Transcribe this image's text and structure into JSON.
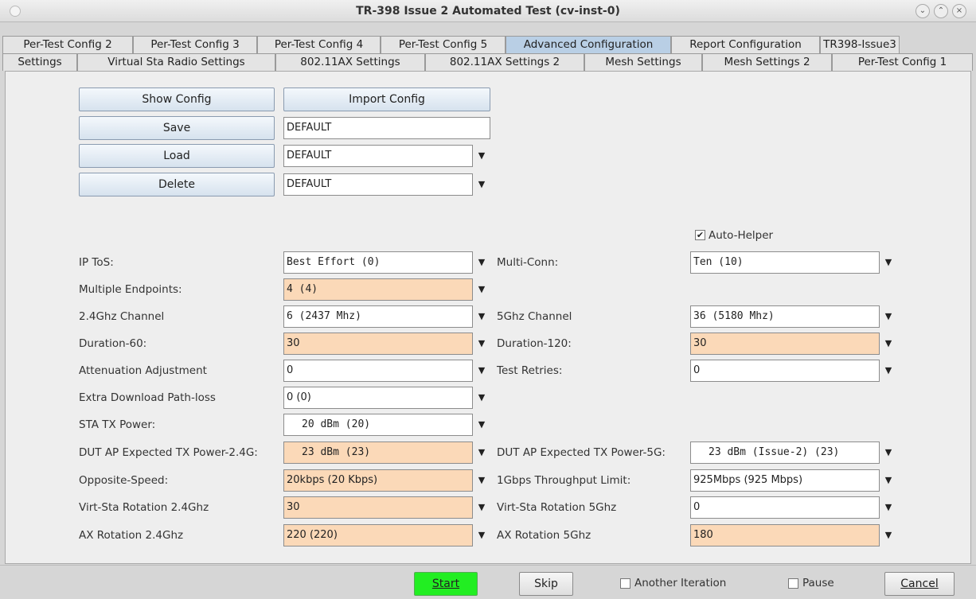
{
  "window": {
    "title": "TR-398 Issue 2 Automated Test  (cv-inst-0)"
  },
  "tabs_top": [
    "Per-Test Config 2",
    "Per-Test Config 3",
    "Per-Test Config 4",
    "Per-Test Config 5",
    "Advanced Configuration",
    "Report Configuration",
    "TR398-Issue3"
  ],
  "tabs_bottom": [
    "Settings",
    "Virtual Sta Radio Settings",
    "802.11AX Settings",
    "802.11AX Settings 2",
    "Mesh Settings",
    "Mesh Settings 2",
    "Per-Test Config 1"
  ],
  "config": {
    "show_config": "Show Config",
    "import_config": "Import Config",
    "save": "Save",
    "save_value": "DEFAULT",
    "load": "Load",
    "load_value": "DEFAULT",
    "delete": "Delete",
    "delete_value": "DEFAULT"
  },
  "auto_helper": {
    "label": "Auto-Helper",
    "checked": true
  },
  "left": {
    "ip_tos_label": "IP ToS:",
    "ip_tos_value": "Best Effort    (0)",
    "multi_endpoints_label": "Multiple Endpoints:",
    "multi_endpoints_value": "4 (4)",
    "ch24_label": "2.4Ghz Channel",
    "ch24_value": "6 (2437 Mhz)",
    "dur60_label": "Duration-60:",
    "dur60_value": "30",
    "atten_label": "Attenuation Adjustment",
    "atten_value": "0",
    "pathloss_label": "Extra Download Path-loss",
    "pathloss_value": "0 (0)",
    "sta_tx_label": "STA TX Power:",
    "sta_tx_value": "20 dBm (20)",
    "dut24_label": "DUT AP Expected TX Power-2.4G:",
    "dut24_value": "23 dBm (23)",
    "opp_speed_label": "Opposite-Speed:",
    "opp_speed_value": "20kbps (20 Kbps)",
    "virt24_label": "Virt-Sta Rotation 2.4Ghz",
    "virt24_value": "30",
    "ax24_label": "AX Rotation 2.4Ghz",
    "ax24_value": "220 (220)"
  },
  "right": {
    "multi_conn_label": "Multi-Conn:",
    "multi_conn_value": "Ten (10)",
    "ch5_label": "5Ghz Channel",
    "ch5_value": "36 (5180 Mhz)",
    "dur120_label": "Duration-120:",
    "dur120_value": "30",
    "retries_label": "Test Retries:",
    "retries_value": "0",
    "dut5_label": "DUT AP Expected TX Power-5G:",
    "dut5_value": "23 dBm (Issue-2) (23)",
    "gbps_label": "1Gbps Throughput Limit:",
    "gbps_value": "925Mbps (925 Mbps)",
    "virt5_label": "Virt-Sta Rotation 5Ghz",
    "virt5_value": "0",
    "ax5_label": "AX Rotation 5Ghz",
    "ax5_value": "180"
  },
  "bottom": {
    "start": "Start",
    "skip": "Skip",
    "another_iteration": "Another Iteration",
    "pause": "Pause",
    "cancel": "Cancel"
  },
  "colors": {
    "start_button": "#22ee22",
    "orange_field": "#fbd9b8",
    "active_tab": "#b9cfe5"
  }
}
